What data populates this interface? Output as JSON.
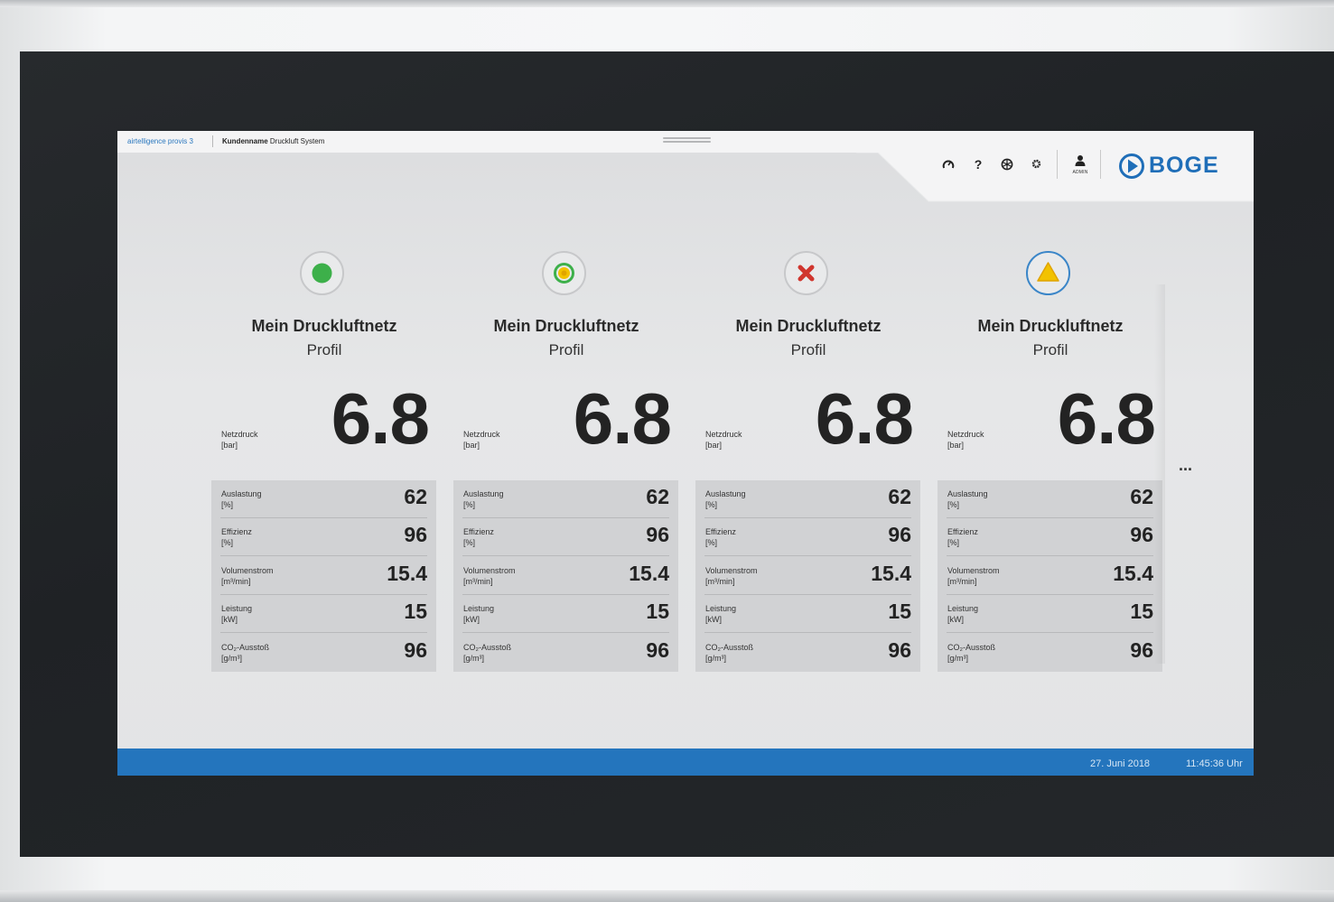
{
  "topbar": {
    "app_name": "airtelligence provis 3",
    "system_name_bold": "Kundenname",
    "system_name_rest": " Druckluft System"
  },
  "header": {
    "icons": [
      "dashboard-gauge-icon",
      "help-icon",
      "network-icon",
      "settings-gear-icon"
    ],
    "admin_label": "ADMIN",
    "logo_text": "BOGE",
    "brand_color": "#1f6eb8"
  },
  "cards": [
    {
      "status": "ok",
      "status_icon": "green-dot-icon",
      "title": "Mein Druckluftnetz",
      "subtitle": "Profil",
      "pressure": {
        "label": "Netzdruck",
        "unit": "[bar]",
        "value": "6.8"
      },
      "metrics": [
        {
          "label": "Auslastung",
          "unit": "[%]",
          "value": "62"
        },
        {
          "label": "Effizienz",
          "unit": "[%]",
          "value": "96"
        },
        {
          "label": "Volumenstrom",
          "unit": "[m³/min]",
          "value": "15.4"
        },
        {
          "label": "Leistung",
          "unit": "[kW]",
          "value": "15"
        },
        {
          "label": "CO₂-Ausstoß",
          "unit": "[g/m³]",
          "value": "96"
        }
      ]
    },
    {
      "status": "idle",
      "status_icon": "yellow-ring-dot-icon",
      "title": "Mein Druckluftnetz",
      "subtitle": "Profil",
      "pressure": {
        "label": "Netzdruck",
        "unit": "[bar]",
        "value": "6.8"
      },
      "metrics": [
        {
          "label": "Auslastung",
          "unit": "[%]",
          "value": "62"
        },
        {
          "label": "Effizienz",
          "unit": "[%]",
          "value": "96"
        },
        {
          "label": "Volumenstrom",
          "unit": "[m³/min]",
          "value": "15.4"
        },
        {
          "label": "Leistung",
          "unit": "[kW]",
          "value": "15"
        },
        {
          "label": "CO₂-Ausstoß",
          "unit": "[g/m³]",
          "value": "96"
        }
      ]
    },
    {
      "status": "error",
      "status_icon": "red-x-icon",
      "title": "Mein Druckluftnetz",
      "subtitle": "Profil",
      "pressure": {
        "label": "Netzdruck",
        "unit": "[bar]",
        "value": "6.8"
      },
      "metrics": [
        {
          "label": "Auslastung",
          "unit": "[%]",
          "value": "62"
        },
        {
          "label": "Effizienz",
          "unit": "[%]",
          "value": "96"
        },
        {
          "label": "Volumenstrom",
          "unit": "[m³/min]",
          "value": "15.4"
        },
        {
          "label": "Leistung",
          "unit": "[kW]",
          "value": "15"
        },
        {
          "label": "CO₂-Ausstoß",
          "unit": "[g/m³]",
          "value": "96"
        }
      ]
    },
    {
      "status": "warning",
      "status_icon": "yellow-triangle-icon",
      "title": "Mein Druckluftnetz",
      "subtitle": "Profil",
      "pressure": {
        "label": "Netzdruck",
        "unit": "[bar]",
        "value": "6.8"
      },
      "metrics": [
        {
          "label": "Auslastung",
          "unit": "[%]",
          "value": "62"
        },
        {
          "label": "Effizienz",
          "unit": "[%]",
          "value": "96"
        },
        {
          "label": "Volumenstrom",
          "unit": "[m³/min]",
          "value": "15.4"
        },
        {
          "label": "Leistung",
          "unit": "[kW]",
          "value": "15"
        },
        {
          "label": "CO₂-Ausstoß",
          "unit": "[g/m³]",
          "value": "96"
        }
      ]
    }
  ],
  "more_button": "...",
  "statusbar": {
    "date": "27. Juni 2018",
    "time": "11:45:36 Uhr",
    "color": "#2475bd"
  }
}
